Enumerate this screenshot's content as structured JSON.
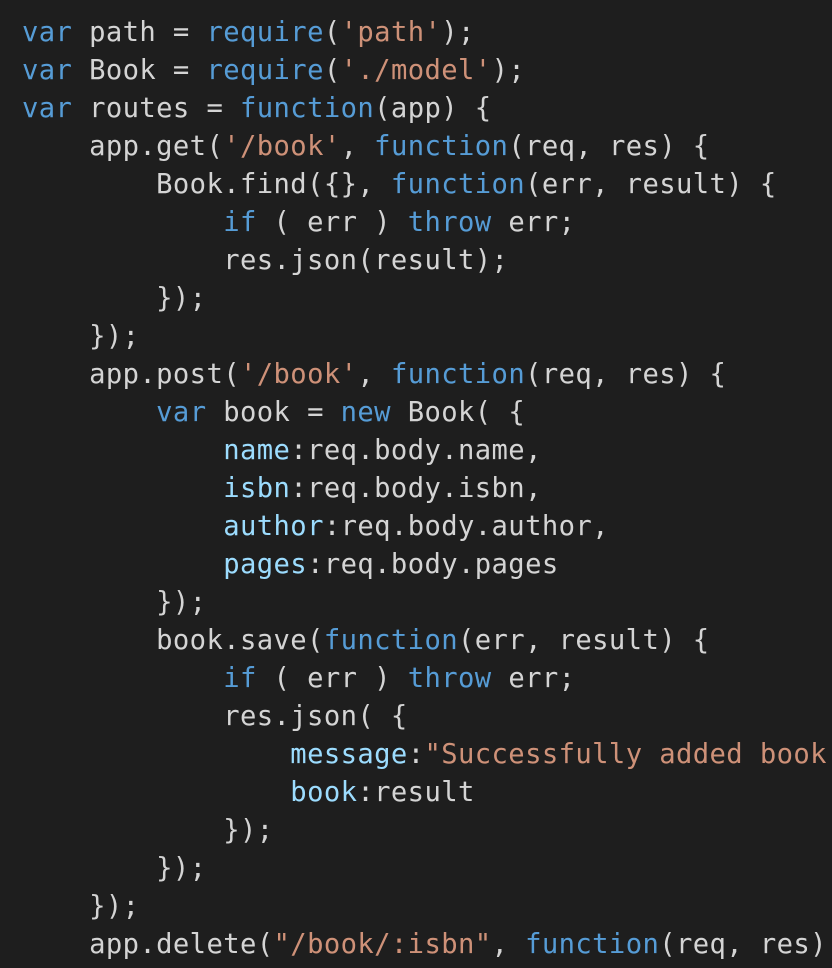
{
  "theme": {
    "background": "#1e1e1e",
    "default_text": "#d4d4d4",
    "keyword": "#569cd6",
    "string": "#ce9178",
    "property": "#9cdcfe"
  },
  "code_lines": [
    [
      {
        "t": "kw",
        "v": "var"
      },
      {
        "t": "plain",
        "v": " path = "
      },
      {
        "t": "fn",
        "v": "require"
      },
      {
        "t": "plain",
        "v": "("
      },
      {
        "t": "str",
        "v": "'path'"
      },
      {
        "t": "plain",
        "v": ");"
      }
    ],
    [
      {
        "t": "kw",
        "v": "var"
      },
      {
        "t": "plain",
        "v": " Book = "
      },
      {
        "t": "fn",
        "v": "require"
      },
      {
        "t": "plain",
        "v": "("
      },
      {
        "t": "str",
        "v": "'./model'"
      },
      {
        "t": "plain",
        "v": ");"
      }
    ],
    [
      {
        "t": "kw",
        "v": "var"
      },
      {
        "t": "plain",
        "v": " routes = "
      },
      {
        "t": "kw",
        "v": "function"
      },
      {
        "t": "plain",
        "v": "(app) {"
      }
    ],
    [
      {
        "t": "plain",
        "v": "    app.get("
      },
      {
        "t": "str",
        "v": "'/book'"
      },
      {
        "t": "plain",
        "v": ", "
      },
      {
        "t": "kw",
        "v": "function"
      },
      {
        "t": "plain",
        "v": "(req, res) {"
      }
    ],
    [
      {
        "t": "plain",
        "v": "        Book.find({}, "
      },
      {
        "t": "kw",
        "v": "function"
      },
      {
        "t": "plain",
        "v": "(err, result) {"
      }
    ],
    [
      {
        "t": "plain",
        "v": "            "
      },
      {
        "t": "kw",
        "v": "if"
      },
      {
        "t": "plain",
        "v": " ( err ) "
      },
      {
        "t": "kw",
        "v": "throw"
      },
      {
        "t": "plain",
        "v": " err;"
      }
    ],
    [
      {
        "t": "plain",
        "v": "            res.json(result);"
      }
    ],
    [
      {
        "t": "plain",
        "v": "        });"
      }
    ],
    [
      {
        "t": "plain",
        "v": "    });"
      }
    ],
    [
      {
        "t": "plain",
        "v": "    app.post("
      },
      {
        "t": "str",
        "v": "'/book'"
      },
      {
        "t": "plain",
        "v": ", "
      },
      {
        "t": "kw",
        "v": "function"
      },
      {
        "t": "plain",
        "v": "(req, res) {"
      }
    ],
    [
      {
        "t": "plain",
        "v": "        "
      },
      {
        "t": "kw",
        "v": "var"
      },
      {
        "t": "plain",
        "v": " book = "
      },
      {
        "t": "kw",
        "v": "new"
      },
      {
        "t": "plain",
        "v": " Book( {"
      }
    ],
    [
      {
        "t": "plain",
        "v": "            "
      },
      {
        "t": "prop",
        "v": "name"
      },
      {
        "t": "plain",
        "v": ":req.body.name,"
      }
    ],
    [
      {
        "t": "plain",
        "v": "            "
      },
      {
        "t": "prop",
        "v": "isbn"
      },
      {
        "t": "plain",
        "v": ":req.body.isbn,"
      }
    ],
    [
      {
        "t": "plain",
        "v": "            "
      },
      {
        "t": "prop",
        "v": "author"
      },
      {
        "t": "plain",
        "v": ":req.body.author,"
      }
    ],
    [
      {
        "t": "plain",
        "v": "            "
      },
      {
        "t": "prop",
        "v": "pages"
      },
      {
        "t": "plain",
        "v": ":req.body.pages"
      }
    ],
    [
      {
        "t": "plain",
        "v": "        });"
      }
    ],
    [
      {
        "t": "plain",
        "v": "        book.save("
      },
      {
        "t": "kw",
        "v": "function"
      },
      {
        "t": "plain",
        "v": "(err, result) {"
      }
    ],
    [
      {
        "t": "plain",
        "v": "            "
      },
      {
        "t": "kw",
        "v": "if"
      },
      {
        "t": "plain",
        "v": " ( err ) "
      },
      {
        "t": "kw",
        "v": "throw"
      },
      {
        "t": "plain",
        "v": " err;"
      }
    ],
    [
      {
        "t": "plain",
        "v": "            res.json( {"
      }
    ],
    [
      {
        "t": "plain",
        "v": "                "
      },
      {
        "t": "prop",
        "v": "message"
      },
      {
        "t": "plain",
        "v": ":"
      },
      {
        "t": "str",
        "v": "\"Successfully added book"
      }
    ],
    [
      {
        "t": "plain",
        "v": "                "
      },
      {
        "t": "prop",
        "v": "book"
      },
      {
        "t": "plain",
        "v": ":result"
      }
    ],
    [
      {
        "t": "plain",
        "v": "            });"
      }
    ],
    [
      {
        "t": "plain",
        "v": "        });"
      }
    ],
    [
      {
        "t": "plain",
        "v": "    });"
      }
    ],
    [
      {
        "t": "plain",
        "v": "    app.delete("
      },
      {
        "t": "str",
        "v": "\"/book/:isbn\""
      },
      {
        "t": "plain",
        "v": ", "
      },
      {
        "t": "kw",
        "v": "function"
      },
      {
        "t": "plain",
        "v": "(req, res)"
      }
    ]
  ]
}
